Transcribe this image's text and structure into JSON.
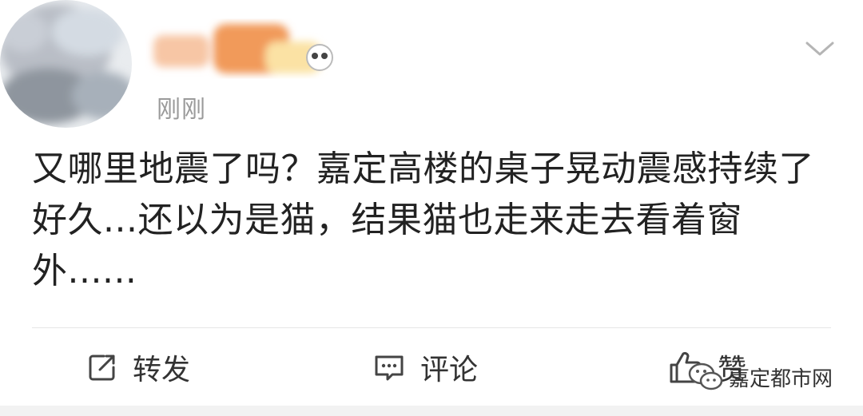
{
  "post": {
    "timestamp": "刚刚",
    "text": "又哪里地震了吗？嘉定高楼的桌子晃动震感持续了好久...还以为是猫，结果猫也走来走去看着窗外......"
  },
  "actions": {
    "repost_label": "转发",
    "comment_label": "评论",
    "like_label": "赞"
  },
  "watermark": {
    "text": "嘉定都市网"
  },
  "icons": {
    "menu": "chevron-down-icon",
    "repost": "share-icon",
    "comment": "comment-icon",
    "like": "thumbs-up-icon",
    "watermark": "wechat-icon"
  }
}
